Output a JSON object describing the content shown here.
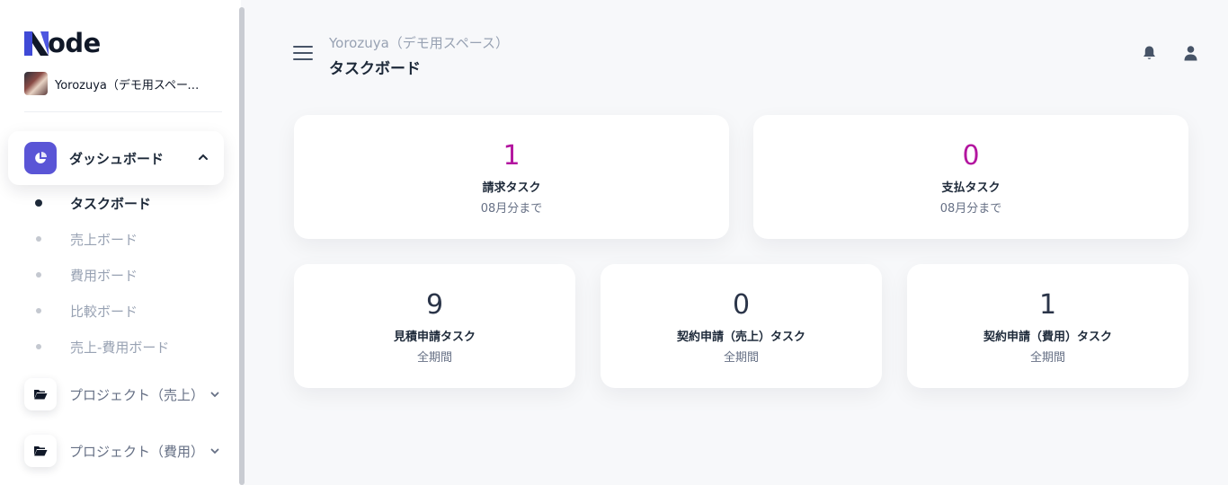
{
  "brand": {
    "logo_text": "ode",
    "accent": "#5a55d6",
    "logo_color": "#101828"
  },
  "workspace": {
    "name": "Yorozuya（デモ用スペース）"
  },
  "sidebar": {
    "active": {
      "label": "ダッシュボード",
      "icon": "pie-chart-icon",
      "chevron": "chevron-up-icon"
    },
    "sub_items": [
      {
        "label": "タスクボード",
        "current": true
      },
      {
        "label": "売上ボード"
      },
      {
        "label": "費用ボード"
      },
      {
        "label": "比較ボード"
      },
      {
        "label": "売上-費用ボード"
      }
    ],
    "groups": [
      {
        "label": "プロジェクト（売上）",
        "icon": "folder-open-icon"
      },
      {
        "label": "プロジェクト（費用）",
        "icon": "folder-open-icon"
      }
    ]
  },
  "header": {
    "breadcrumb": "Yorozuya（デモ用スペース）",
    "title": "タスクボード",
    "icons": [
      "menu-icon",
      "bell-icon",
      "user-icon"
    ]
  },
  "cards": [
    {
      "value": "1",
      "title": "請求タスク",
      "subtitle": "08月分まで",
      "color": "#b3159f"
    },
    {
      "value": "0",
      "title": "支払タスク",
      "subtitle": "08月分まで",
      "color": "#b3159f"
    },
    {
      "value": "9",
      "title": "見積申請タスク",
      "subtitle": "全期間",
      "color": "#2b3549"
    },
    {
      "value": "0",
      "title": "契約申請（売上）タスク",
      "subtitle": "全期間",
      "color": "#2b3549"
    },
    {
      "value": "1",
      "title": "契約申請（費用）タスク",
      "subtitle": "全期間",
      "color": "#2b3549"
    }
  ]
}
